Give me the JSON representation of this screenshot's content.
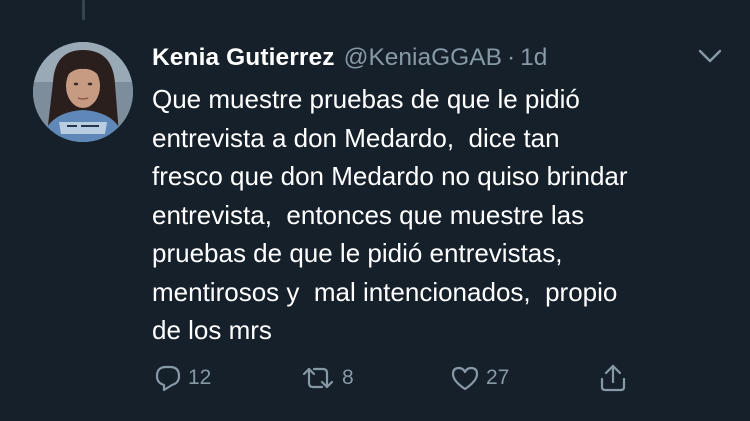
{
  "tweet": {
    "author_name": "Kenia Gutierrez",
    "author_handle": "@KeniaGGAB",
    "separator": "·",
    "timestamp": "1d",
    "text_lines": [
      "Que muestre pruebas de que le pidió",
      "entrevista a don Medardo,  dice tan",
      "fresco que don Medardo no quiso brindar",
      "entrevista,  entonces que muestre las",
      "pruebas de que le pidió entrevistas,",
      "mentirosos y  mal intencionados,  propio",
      "de los mrs"
    ],
    "reply_count": "12",
    "retweet_count": "8",
    "like_count": "27"
  },
  "icons": {
    "more": "chevron-down-icon",
    "reply": "reply-icon",
    "retweet": "retweet-icon",
    "like": "heart-icon",
    "share": "share-icon"
  },
  "colors": {
    "background": "#15202b",
    "text_primary": "#ffffff",
    "text_secondary": "#8899a6",
    "thread_line": "#38444d"
  }
}
